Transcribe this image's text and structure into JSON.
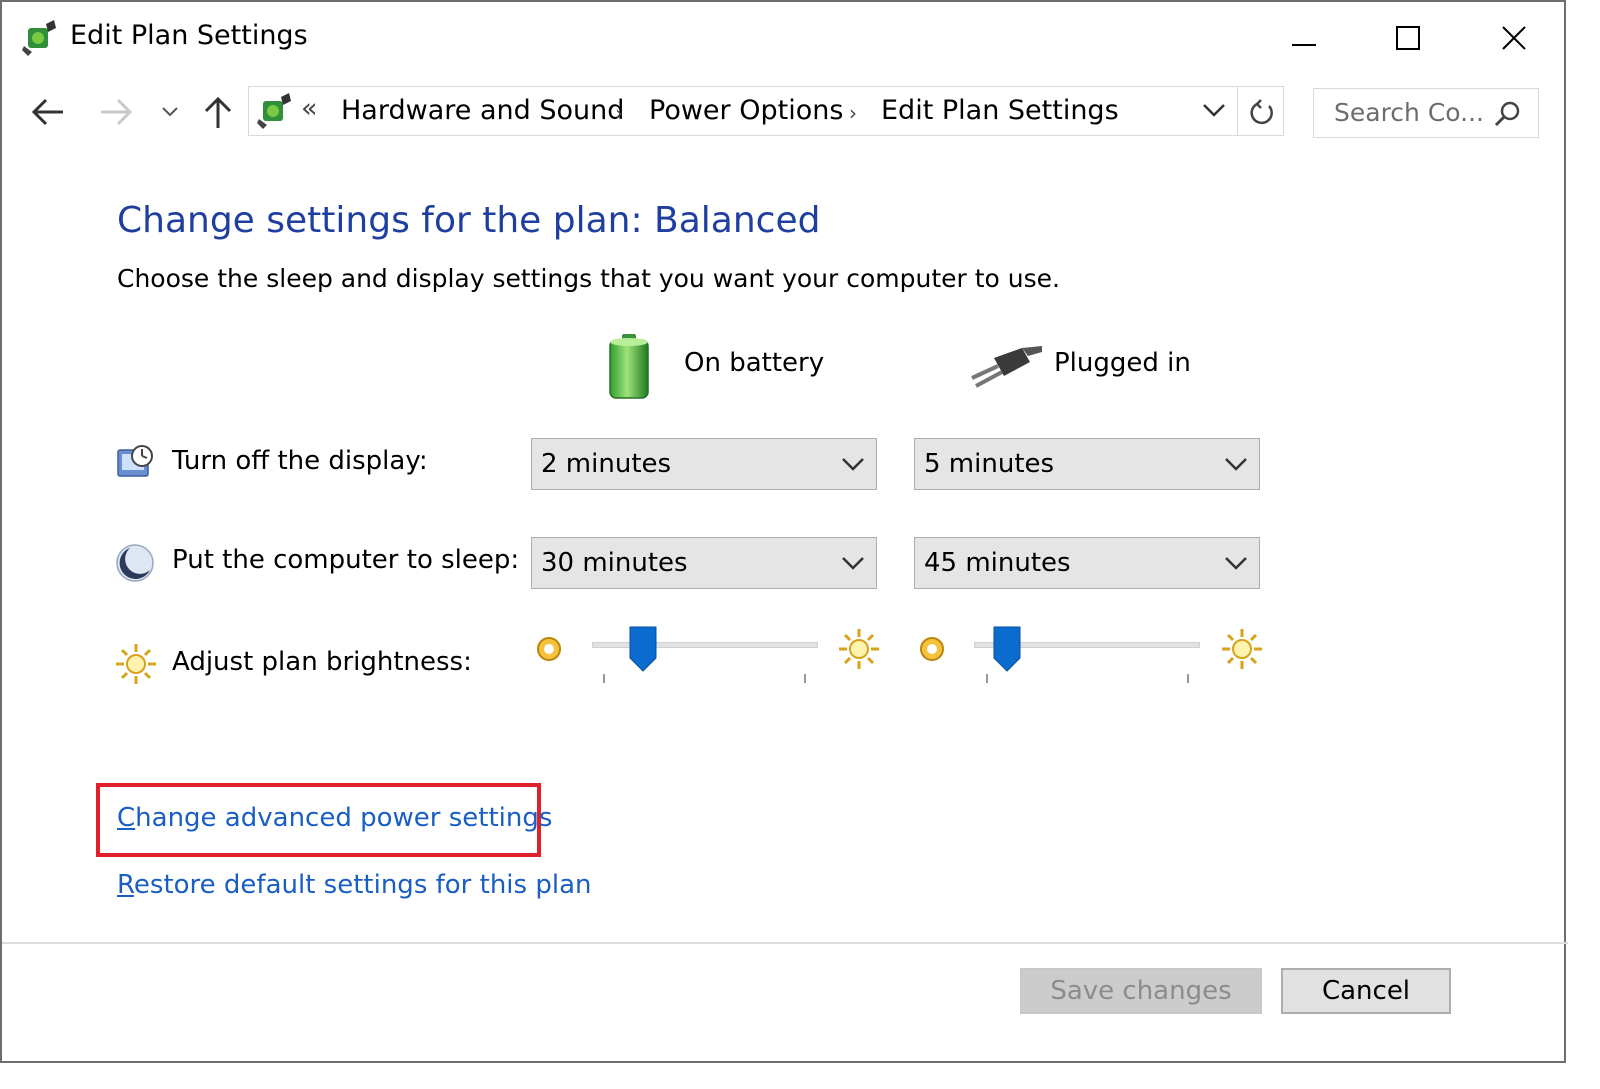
{
  "window": {
    "title": "Edit Plan Settings"
  },
  "address": {
    "overflow": "«",
    "crumbs": [
      "Hardware and Sound",
      "Power Options",
      "Edit Plan Settings"
    ]
  },
  "search": {
    "placeholder": "Search Co..."
  },
  "main": {
    "heading": "Change settings for the plan: Balanced",
    "subheading": "Choose the sleep and display settings that you want your computer to use.",
    "columns": {
      "battery": "On battery",
      "plugged": "Plugged in"
    },
    "rows": {
      "display": {
        "label": "Turn off the display:",
        "battery_value": "2 minutes",
        "plugged_value": "5 minutes"
      },
      "sleep": {
        "label": "Put the computer to sleep:",
        "battery_value": "30 minutes",
        "plugged_value": "45 minutes"
      },
      "brightness": {
        "label": "Adjust plan brightness:",
        "battery_level": 0.15,
        "plugged_level": 0.06
      }
    },
    "links": {
      "advanced": "Change advanced power settings",
      "restore": "Restore default settings for this plan"
    }
  },
  "footer": {
    "save": "Save changes",
    "cancel": "Cancel"
  },
  "colors": {
    "heading": "#1e3fa0",
    "link": "#1a5ec4",
    "highlight": "#e0202a",
    "slider_thumb": "#0a6ccf"
  }
}
